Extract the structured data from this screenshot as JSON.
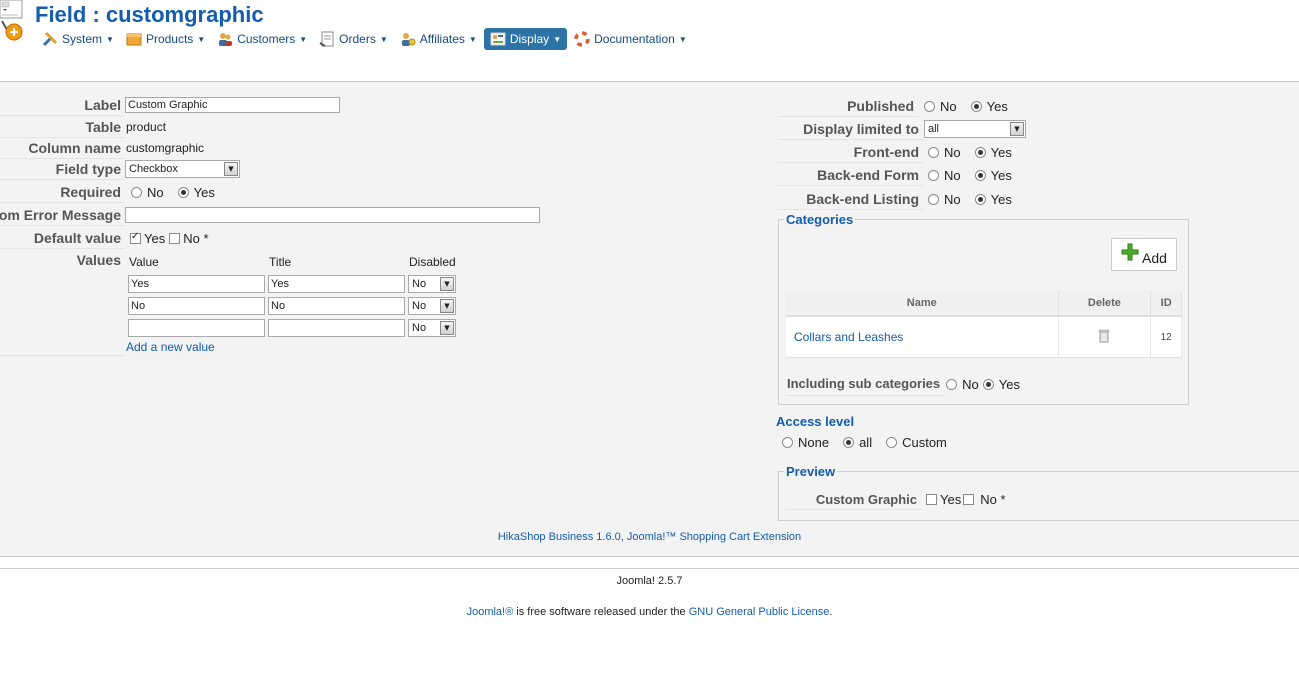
{
  "header": {
    "title": "Field : customgraphic",
    "menu": [
      {
        "label": "System",
        "icon": "wrench-icon"
      },
      {
        "label": "Products",
        "icon": "products-icon"
      },
      {
        "label": "Customers",
        "icon": "customers-icon"
      },
      {
        "label": "Orders",
        "icon": "orders-icon"
      },
      {
        "label": "Affiliates",
        "icon": "affiliates-icon"
      },
      {
        "label": "Display",
        "icon": "display-icon",
        "active": true
      },
      {
        "label": "Documentation",
        "icon": "lifebuoy-icon"
      }
    ]
  },
  "form": {
    "label_label": "Label",
    "label_value": "Custom Graphic",
    "table_label": "Table",
    "table_value": "product",
    "column_label": "Column name",
    "column_value": "customgraphic",
    "fieldtype_label": "Field type",
    "fieldtype_value": "Checkbox",
    "required_label": "Required",
    "required_no": "No",
    "required_yes": "Yes",
    "required_selected": "Yes",
    "custom_error_label": "Custom Error Message",
    "custom_error_value": "",
    "default_label": "Default value",
    "default_yes": "Yes",
    "default_no": "No *",
    "default_yes_checked": true,
    "default_no_checked": false,
    "values_label": "Values",
    "values_headers": {
      "value": "Value",
      "title": "Title",
      "disabled": "Disabled"
    },
    "values_rows": [
      {
        "value": "Yes",
        "title": "Yes",
        "disabled": "No"
      },
      {
        "value": "No",
        "title": "No",
        "disabled": "No"
      },
      {
        "value": "",
        "title": "",
        "disabled": "No"
      }
    ],
    "add_value_link": "Add a new value"
  },
  "right": {
    "published_label": "Published",
    "display_limited_label": "Display limited to",
    "display_limited_value": "all",
    "frontend_label": "Front-end",
    "backend_form_label": "Back-end Form",
    "backend_listing_label": "Back-end Listing",
    "no": "No",
    "yes": "Yes",
    "categories_legend": "Categories",
    "add_button": "Add",
    "cat_headers": {
      "name": "Name",
      "delete": "Delete",
      "id": "ID"
    },
    "cat_rows": [
      {
        "name": "Collars and Leashes",
        "id": "12"
      }
    ],
    "including_sub_label": "Including sub categories",
    "access_level_label": "Access level",
    "access_none": "None",
    "access_all": "all",
    "access_custom": "Custom",
    "preview_legend": "Preview",
    "preview_label": "Custom Graphic",
    "preview_yes": "Yes",
    "preview_no": "No *"
  },
  "footer": {
    "hikashop": "HikaShop Business 1.6.0, Joomla!™ Shopping Cart Extension",
    "joomla_version": "Joomla! 2.5.7",
    "license_prefix": "Joomla!®",
    "license_middle": " is free software released under the ",
    "license_link": "GNU General Public License",
    "license_suffix": "."
  },
  "colors": {
    "title": "#135cae",
    "active_menu": "#2c73a8",
    "panel_bg": "#f3f3f3"
  }
}
